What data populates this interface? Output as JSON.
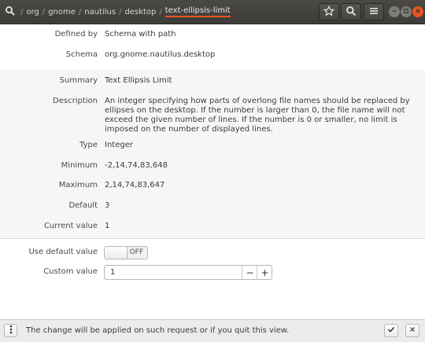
{
  "breadcrumbs": [
    {
      "label": "org"
    },
    {
      "label": "gnome"
    },
    {
      "label": "nautilus"
    },
    {
      "label": "desktop"
    },
    {
      "label": "text-ellipsis-limit"
    }
  ],
  "separator": "/",
  "header_buttons": {
    "bookmark": "star-icon",
    "search": "search-icon",
    "menu": "hamburger-icon"
  },
  "window_controls": {
    "minimize_color": "#7e7d78",
    "maximize_color": "#7e7d78",
    "close_color": "#e95420"
  },
  "info": {
    "defined_by_label": "Defined by",
    "defined_by_value": "Schema with path",
    "schema_label": "Schema",
    "schema_value": "org.gnome.nautilus.desktop",
    "summary_label": "Summary",
    "summary_value": "Text Ellipsis Limit",
    "description_label": "Description",
    "description_value": "An integer specifying how parts of overlong file names should be replaced by ellipses on the desktop. If the number is larger than 0, the file name will not exceed the given number of lines. If the number is 0 or smaller, no limit is imposed on the number of displayed lines.",
    "type_label": "Type",
    "type_value": "Integer",
    "minimum_label": "Minimum",
    "minimum_value": "-2,14,74,83,648",
    "maximum_label": "Maximum",
    "maximum_value": "2,14,74,83,647",
    "default_label": "Default",
    "default_value": "3",
    "current_label": "Current value",
    "current_value": "1"
  },
  "settings": {
    "use_default_label": "Use default value",
    "use_default_state": "OFF",
    "custom_label": "Custom value",
    "custom_value": "1",
    "minus": "−",
    "plus": "+"
  },
  "footer": {
    "message": "The change will be applied on such request or if you quit this view.",
    "accent": "#e95420"
  }
}
